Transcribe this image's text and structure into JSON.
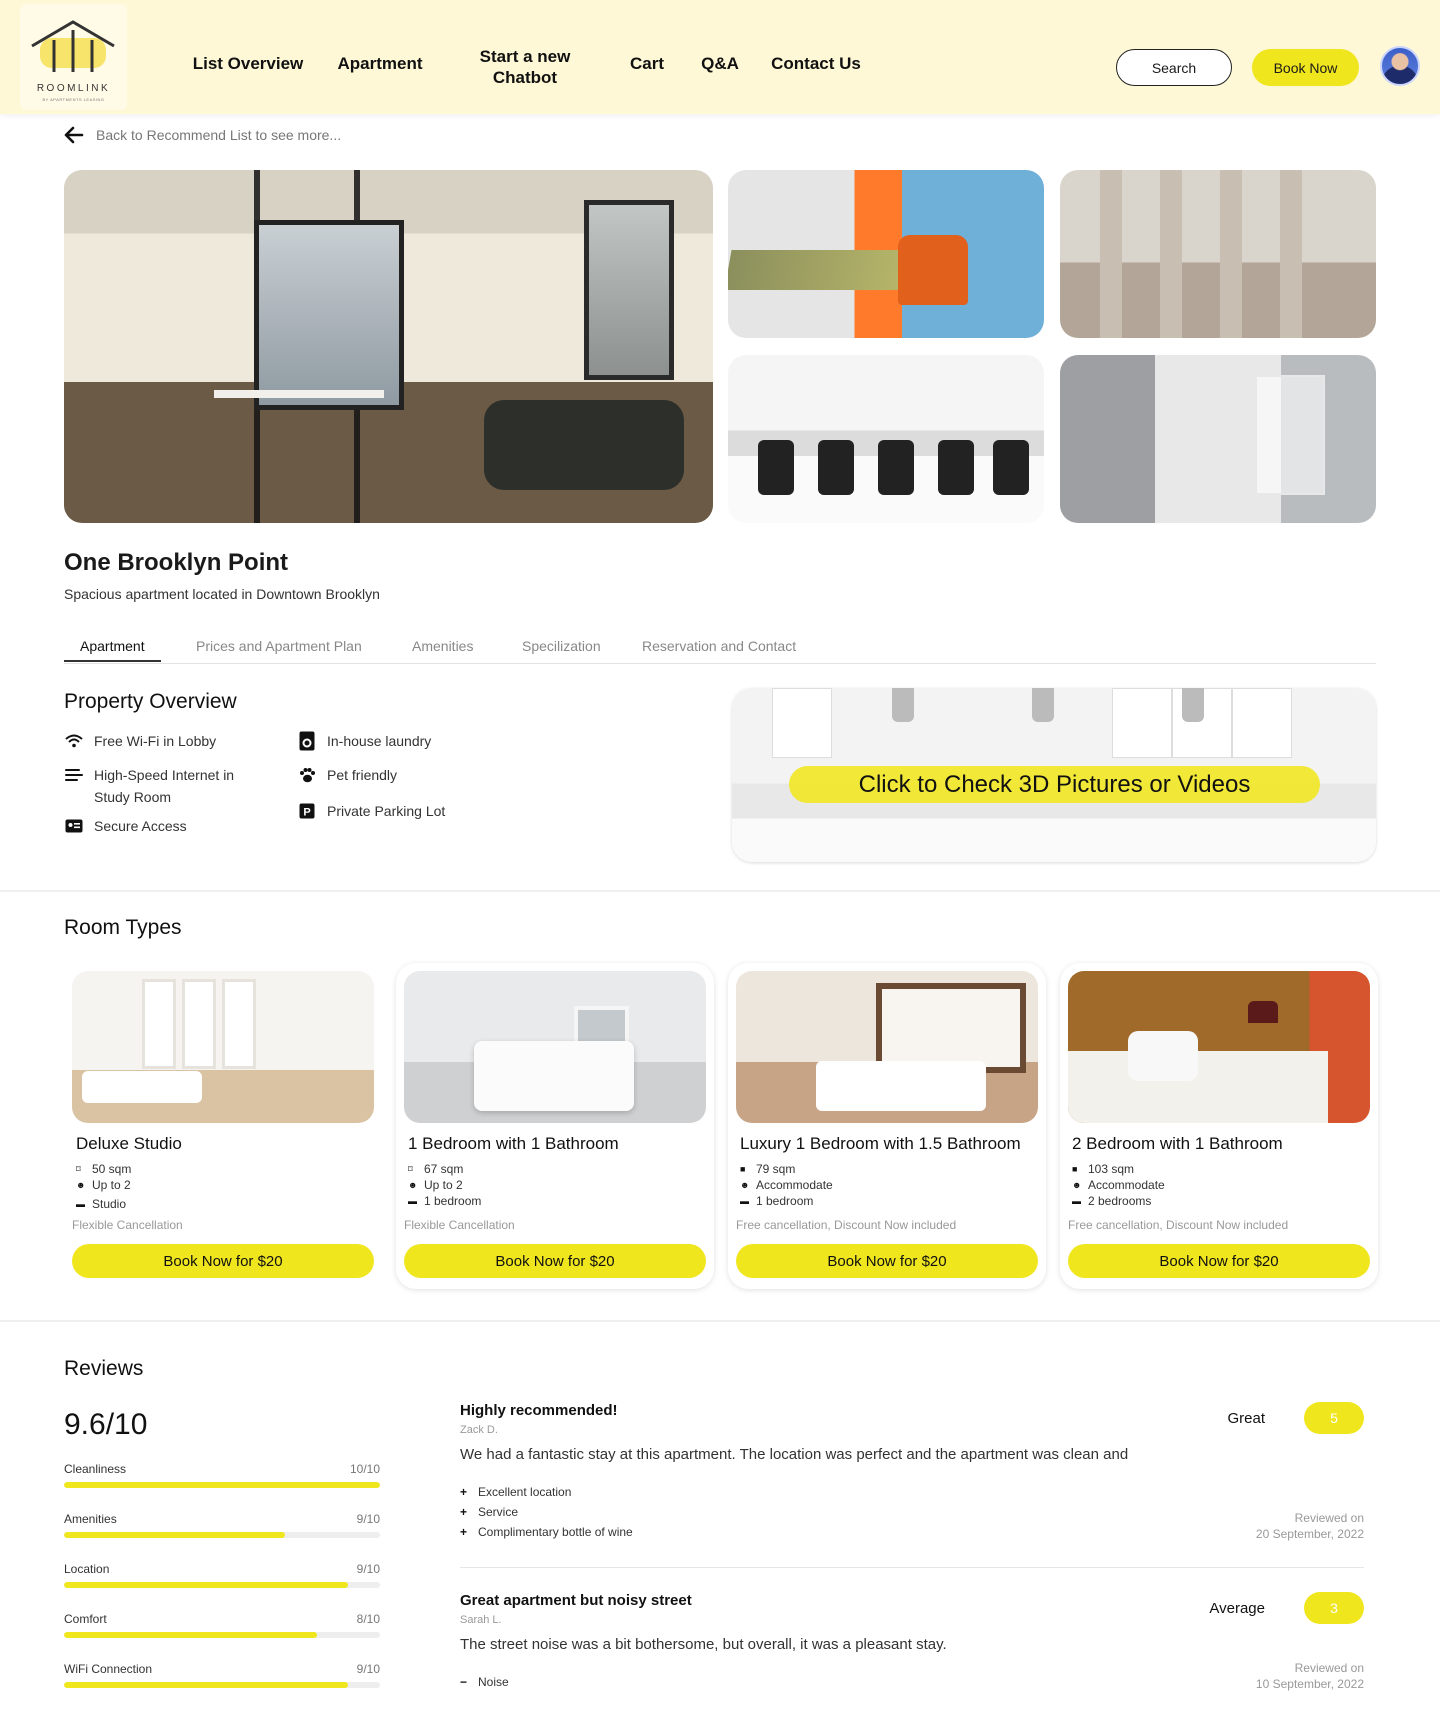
{
  "header": {
    "logo_text": "ROOMLINK",
    "logo_sub": "BY APARTMENTS LEASING",
    "nav": [
      "List Overview",
      "Apartment",
      "Start a new Chatbot",
      "Cart",
      "Q&A",
      "Contact Us"
    ],
    "search_label": "Search",
    "book_label": "Book Now"
  },
  "back_link": "Back to Recommend List to see more...",
  "property": {
    "title": "One Brooklyn Point",
    "subtitle": "Spacious apartment located in Downtown Brooklyn"
  },
  "tabs": [
    "Apartment",
    "Prices and Apartment Plan",
    "Amenities",
    "Specilization",
    "Reservation and Contact"
  ],
  "overview": {
    "heading": "Property Overview",
    "features_left": [
      {
        "icon": "wifi-icon",
        "label": "Free Wi-Fi in Lobby"
      },
      {
        "icon": "speed-icon",
        "label": "High-Speed Internet in Study Room"
      },
      {
        "icon": "id-card-icon",
        "label": "Secure Access"
      }
    ],
    "features_right": [
      {
        "icon": "washer-icon",
        "label": "In-house laundry"
      },
      {
        "icon": "paw-icon",
        "label": "Pet friendly"
      },
      {
        "icon": "parking-icon",
        "label": "Private Parking Lot"
      }
    ],
    "cta_3d": "Click to Check 3D Pictures or Videos"
  },
  "rooms": {
    "heading": "Room Types",
    "items": [
      {
        "name": "Deluxe Studio",
        "size": "50 sqm",
        "guests": "Up to 2",
        "beds": "Studio",
        "cancel": "Flexible Cancellation",
        "button": "Book Now for $20"
      },
      {
        "name": "1 Bedroom with 1 Bathroom",
        "size": "67 sqm",
        "guests": "Up to 2",
        "beds": "1 bedroom",
        "cancel": "Flexible Cancellation",
        "button": "Book Now for $20"
      },
      {
        "name": "Luxury 1 Bedroom with 1.5 Bathroom",
        "size": "79 sqm",
        "guests": "Accommodate",
        "beds": "1 bedroom",
        "cancel": "Free cancellation, Discount Now included",
        "button": "Book Now for $20"
      },
      {
        "name": "2 Bedroom with 1 Bathroom",
        "size": "103 sqm",
        "guests": "Accommodate",
        "beds": "2 bedrooms",
        "cancel": "Free cancellation, Discount Now included",
        "button": "Book Now for $20"
      }
    ]
  },
  "reviews": {
    "heading": "Reviews",
    "score": "9.6/10",
    "breakdown": [
      {
        "label": "Cleanliness",
        "value": "10/10",
        "fraction": 1.0
      },
      {
        "label": "Amenities",
        "value": "9/10",
        "fraction": 0.7
      },
      {
        "label": "Location",
        "value": "9/10",
        "fraction": 0.9
      },
      {
        "label": "Comfort",
        "value": "8/10",
        "fraction": 0.8
      },
      {
        "label": "WiFi Connection",
        "value": "9/10",
        "fraction": 0.9
      }
    ],
    "items": [
      {
        "title": "Highly recommended!",
        "author": "Zack D.",
        "text": "We had a fantastic stay at this apartment. The location was perfect and the apartment was clean and",
        "points": [
          "Excellent location",
          "Service",
          "Complimentary bottle of wine"
        ],
        "point_sign": "+",
        "rating_word": "Great",
        "rating": "5",
        "reviewed_label": "Reviewed on",
        "date": "20 September, 2022"
      },
      {
        "title": "Great apartment but noisy street",
        "author": "Sarah L.",
        "text": "The street noise was a bit bothersome, but overall, it was a pleasant stay.",
        "points": [
          "Noise"
        ],
        "point_sign": "−",
        "rating_word": "Average",
        "rating": "3",
        "reviewed_label": "Reviewed on",
        "date": "10 September, 2022"
      }
    ]
  },
  "colors": {
    "accent": "#f0e61e",
    "header_bg": "#fef8d6"
  }
}
